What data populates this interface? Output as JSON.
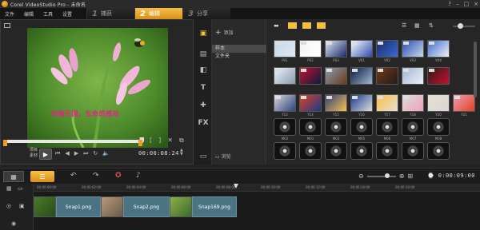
{
  "app": {
    "title": "Corel VideoStudio Pro - 未命名",
    "window_buttons": [
      "?",
      "–",
      "□",
      "×"
    ]
  },
  "menu": [
    "文件",
    "编辑",
    "工具",
    "设置"
  ],
  "steps": [
    {
      "num": "1",
      "label": "捕获",
      "active": false
    },
    {
      "num": "2",
      "label": "编辑",
      "active": true
    },
    {
      "num": "3",
      "label": "分享",
      "active": false
    }
  ],
  "preview": {
    "caption": "动物王国，生命的感动",
    "mode_project": "项目",
    "mode_clip": "素材",
    "timecode": "00:00:08:24",
    "progress": 0.98
  },
  "folders": {
    "add_label": "添加",
    "items": [
      {
        "label": "样本",
        "selected": true
      },
      {
        "label": "文件夹",
        "selected": false
      }
    ],
    "browse_label": "浏览"
  },
  "library": {
    "rows": [
      [
        "P01",
        "P02",
        "P03",
        "V01",
        "V02",
        "V03",
        "V04"
      ],
      [
        "",
        "",
        "",
        "",
        "",
        "",
        ""
      ],
      [
        "Y12",
        "Y14",
        "Y15",
        "Y16",
        "Y17",
        "Y18",
        "Y20",
        "Y21"
      ],
      [
        "M02",
        "M01",
        "M03",
        "M05",
        "M06",
        "M07",
        "M08"
      ],
      [
        "",
        "",
        "",
        "",
        "",
        "",
        ""
      ]
    ]
  },
  "timeline": {
    "time": "0:00:09:00",
    "ruler_ticks": [
      "00:00:00:00",
      "00:00:02:00",
      "00:00:04:00",
      "00:00:06:00",
      "00:00:08:00",
      "00:00:10:00",
      "00:00:12:00",
      "00:00:14:00",
      "00:00:16:00"
    ],
    "clips": [
      "Snap1.png",
      "Snap2.png",
      "Snap169.png"
    ]
  },
  "colors": {
    "accent": "#f3c23a",
    "clip": "#4a7383",
    "caption": "#e8208a"
  }
}
